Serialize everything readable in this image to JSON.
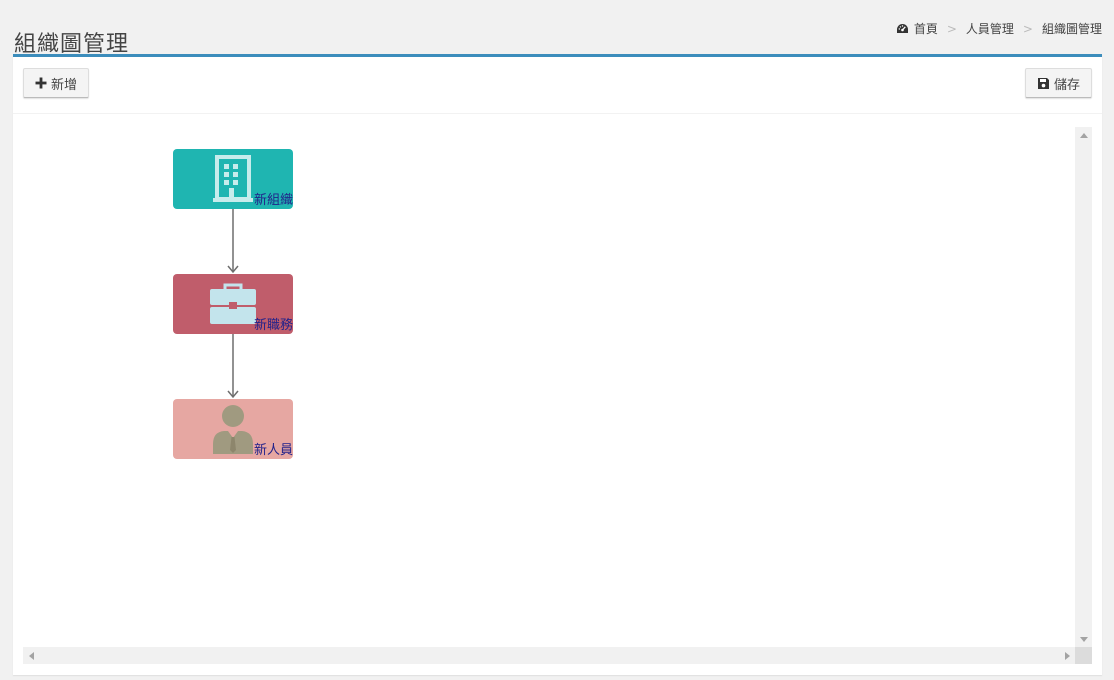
{
  "header": {
    "title": "組織圖管理",
    "breadcrumb": [
      {
        "label": "首頁",
        "icon": "dashboard-icon"
      },
      {
        "label": "人員管理"
      },
      {
        "label": "組織圖管理"
      }
    ],
    "separator": ">"
  },
  "toolbar": {
    "add_label": "新增",
    "add_icon": "plus-icon",
    "save_label": "儲存",
    "save_icon": "floppy-disk-icon"
  },
  "chart": {
    "nodes": [
      {
        "label": "新組織",
        "icon": "building-icon",
        "color": "#1fb5b1"
      },
      {
        "label": "新職務",
        "icon": "briefcase-icon",
        "color": "#c05d6b"
      },
      {
        "label": "新人員",
        "icon": "person-icon",
        "color": "#e6a7a2"
      }
    ]
  },
  "colors": {
    "accent": "#3c8dbc",
    "node_label": "#22228a"
  }
}
